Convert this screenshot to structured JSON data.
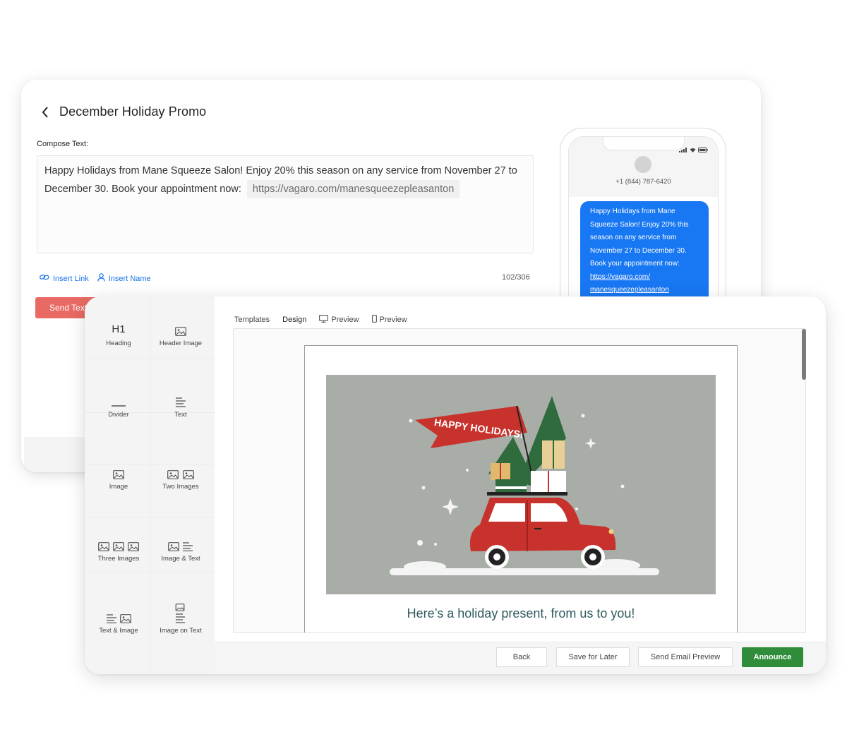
{
  "sms": {
    "title": "December Holiday Promo",
    "compose_label": "Compose Text:",
    "message_text": "Happy Holidays from Mane Squeeze Salon! Enjoy 20% this season on any service from November 27 to December 30. Book your appointment now:",
    "message_link": "https://vagaro.com/manesqueezepleasanton",
    "insert_link_label": "Insert Link",
    "insert_name_label": "Insert Name",
    "char_count": "102/306",
    "send_button_label": "Send Text",
    "phone": {
      "number": "+1 (844) 787-6420",
      "bubble_lines": [
        "Happy Holidays from Mane",
        "Squeeze Salon! Enjoy 20% this",
        "season on any service from",
        "November 27 to December 30.",
        "Book your appointment now:"
      ],
      "bubble_link_lines": [
        "https://vagaro.com/",
        "manesqueezepleasanton"
      ]
    }
  },
  "email_builder": {
    "palette": [
      {
        "label": "Heading",
        "icon": "heading-h1-icon",
        "glyph": "H1"
      },
      {
        "label": "Header Image",
        "icon": "header-image-icon"
      },
      {
        "label": "Divider",
        "icon": "divider-icon"
      },
      {
        "label": "Text",
        "icon": "text-lines-icon"
      },
      {
        "label": "Image",
        "icon": "image-icon"
      },
      {
        "label": "Two Images",
        "icon": "two-images-icon"
      },
      {
        "label": "Three Images",
        "icon": "three-images-icon"
      },
      {
        "label": "Image & Text",
        "icon": "image-text-icon"
      },
      {
        "label": "Text & Image",
        "icon": "text-image-icon"
      },
      {
        "label": "Image on Text",
        "icon": "image-on-text-icon"
      }
    ],
    "tabs": [
      {
        "label": "Templates",
        "active": false
      },
      {
        "label": "Design",
        "active": true
      },
      {
        "label": "Preview",
        "icon": "desktop-icon",
        "active": false
      },
      {
        "label": "Preview",
        "icon": "mobile-icon",
        "active": false
      }
    ],
    "hero": {
      "banner_text": "HAPPY HOLIDAYS!",
      "background_color": "#a8ada7",
      "car_color": "#c8322c",
      "tree_color": "#2f6b3c"
    },
    "email_headline": "Here’s a holiday present, from us to you!",
    "buttons": {
      "back": "Back",
      "save_for_later": "Save for Later",
      "send_email_preview": "Send Email Preview",
      "announce": "Announce"
    }
  },
  "colors": {
    "send_text_button": "#e96a64",
    "announce_button": "#2f8c3a",
    "sms_bubble": "#1877f2",
    "link_blue": "#1a73e8",
    "headline_teal": "#2f5a5d"
  }
}
